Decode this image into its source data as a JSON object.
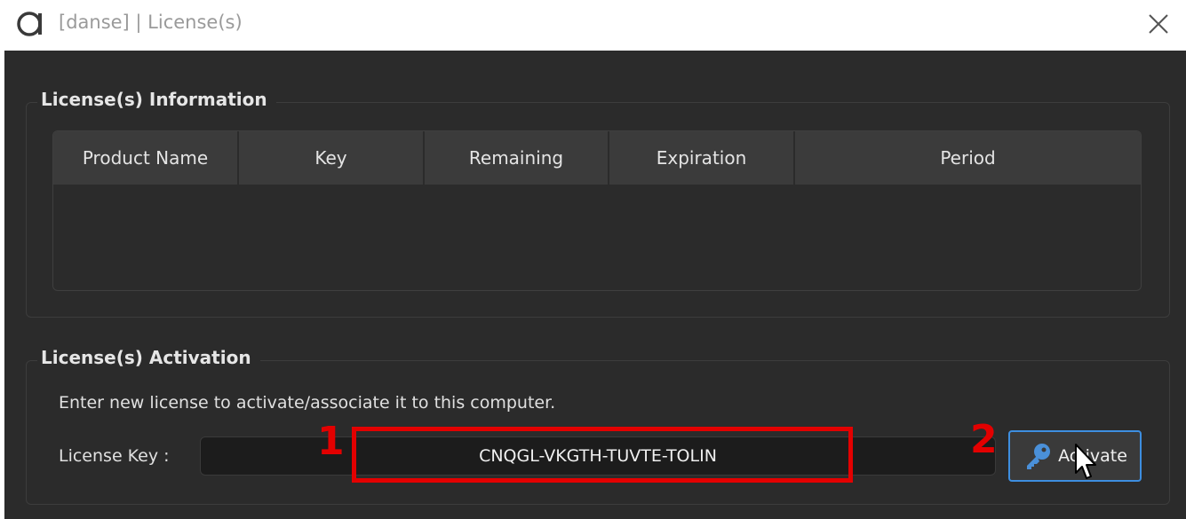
{
  "window": {
    "title": "[danse] | License(s)",
    "icons": {
      "logo": "app-logo-icon",
      "close": "close-icon"
    }
  },
  "info": {
    "title": "License(s) Information",
    "columns": [
      "Product Name",
      "Key",
      "Remaining",
      "Expiration",
      "Period"
    ],
    "rows": []
  },
  "activation": {
    "title": "License(s) Activation",
    "instruction": "Enter new license to activate/associate it to this computer.",
    "key_label": "License Key :",
    "key_value": "CNQGL-VKGTH-TUVTE-TOLIN",
    "button_label": "Activate",
    "button_icon": "key-icon"
  },
  "annotations": {
    "step1": "1",
    "step2": "2",
    "color": "#e30000"
  },
  "colors": {
    "background": "#2b2b2b",
    "header": "#3b3b3b",
    "accent_border": "#3d8ee0",
    "key_icon": "#4a90d9"
  }
}
